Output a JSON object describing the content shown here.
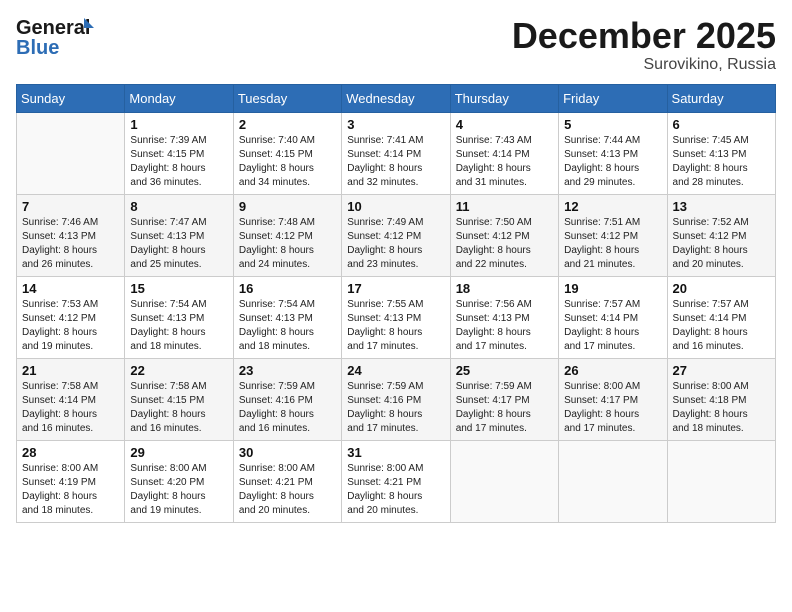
{
  "header": {
    "logo_general": "General",
    "logo_blue": "Blue",
    "month_title": "December 2025",
    "location": "Surovikino, Russia"
  },
  "weekdays": [
    "Sunday",
    "Monday",
    "Tuesday",
    "Wednesday",
    "Thursday",
    "Friday",
    "Saturday"
  ],
  "weeks": [
    [
      {
        "day": "",
        "info": ""
      },
      {
        "day": "1",
        "info": "Sunrise: 7:39 AM\nSunset: 4:15 PM\nDaylight: 8 hours\nand 36 minutes."
      },
      {
        "day": "2",
        "info": "Sunrise: 7:40 AM\nSunset: 4:15 PM\nDaylight: 8 hours\nand 34 minutes."
      },
      {
        "day": "3",
        "info": "Sunrise: 7:41 AM\nSunset: 4:14 PM\nDaylight: 8 hours\nand 32 minutes."
      },
      {
        "day": "4",
        "info": "Sunrise: 7:43 AM\nSunset: 4:14 PM\nDaylight: 8 hours\nand 31 minutes."
      },
      {
        "day": "5",
        "info": "Sunrise: 7:44 AM\nSunset: 4:13 PM\nDaylight: 8 hours\nand 29 minutes."
      },
      {
        "day": "6",
        "info": "Sunrise: 7:45 AM\nSunset: 4:13 PM\nDaylight: 8 hours\nand 28 minutes."
      }
    ],
    [
      {
        "day": "7",
        "info": "Sunrise: 7:46 AM\nSunset: 4:13 PM\nDaylight: 8 hours\nand 26 minutes."
      },
      {
        "day": "8",
        "info": "Sunrise: 7:47 AM\nSunset: 4:13 PM\nDaylight: 8 hours\nand 25 minutes."
      },
      {
        "day": "9",
        "info": "Sunrise: 7:48 AM\nSunset: 4:12 PM\nDaylight: 8 hours\nand 24 minutes."
      },
      {
        "day": "10",
        "info": "Sunrise: 7:49 AM\nSunset: 4:12 PM\nDaylight: 8 hours\nand 23 minutes."
      },
      {
        "day": "11",
        "info": "Sunrise: 7:50 AM\nSunset: 4:12 PM\nDaylight: 8 hours\nand 22 minutes."
      },
      {
        "day": "12",
        "info": "Sunrise: 7:51 AM\nSunset: 4:12 PM\nDaylight: 8 hours\nand 21 minutes."
      },
      {
        "day": "13",
        "info": "Sunrise: 7:52 AM\nSunset: 4:12 PM\nDaylight: 8 hours\nand 20 minutes."
      }
    ],
    [
      {
        "day": "14",
        "info": "Sunrise: 7:53 AM\nSunset: 4:12 PM\nDaylight: 8 hours\nand 19 minutes."
      },
      {
        "day": "15",
        "info": "Sunrise: 7:54 AM\nSunset: 4:13 PM\nDaylight: 8 hours\nand 18 minutes."
      },
      {
        "day": "16",
        "info": "Sunrise: 7:54 AM\nSunset: 4:13 PM\nDaylight: 8 hours\nand 18 minutes."
      },
      {
        "day": "17",
        "info": "Sunrise: 7:55 AM\nSunset: 4:13 PM\nDaylight: 8 hours\nand 17 minutes."
      },
      {
        "day": "18",
        "info": "Sunrise: 7:56 AM\nSunset: 4:13 PM\nDaylight: 8 hours\nand 17 minutes."
      },
      {
        "day": "19",
        "info": "Sunrise: 7:57 AM\nSunset: 4:14 PM\nDaylight: 8 hours\nand 17 minutes."
      },
      {
        "day": "20",
        "info": "Sunrise: 7:57 AM\nSunset: 4:14 PM\nDaylight: 8 hours\nand 16 minutes."
      }
    ],
    [
      {
        "day": "21",
        "info": "Sunrise: 7:58 AM\nSunset: 4:14 PM\nDaylight: 8 hours\nand 16 minutes."
      },
      {
        "day": "22",
        "info": "Sunrise: 7:58 AM\nSunset: 4:15 PM\nDaylight: 8 hours\nand 16 minutes."
      },
      {
        "day": "23",
        "info": "Sunrise: 7:59 AM\nSunset: 4:16 PM\nDaylight: 8 hours\nand 16 minutes."
      },
      {
        "day": "24",
        "info": "Sunrise: 7:59 AM\nSunset: 4:16 PM\nDaylight: 8 hours\nand 17 minutes."
      },
      {
        "day": "25",
        "info": "Sunrise: 7:59 AM\nSunset: 4:17 PM\nDaylight: 8 hours\nand 17 minutes."
      },
      {
        "day": "26",
        "info": "Sunrise: 8:00 AM\nSunset: 4:17 PM\nDaylight: 8 hours\nand 17 minutes."
      },
      {
        "day": "27",
        "info": "Sunrise: 8:00 AM\nSunset: 4:18 PM\nDaylight: 8 hours\nand 18 minutes."
      }
    ],
    [
      {
        "day": "28",
        "info": "Sunrise: 8:00 AM\nSunset: 4:19 PM\nDaylight: 8 hours\nand 18 minutes."
      },
      {
        "day": "29",
        "info": "Sunrise: 8:00 AM\nSunset: 4:20 PM\nDaylight: 8 hours\nand 19 minutes."
      },
      {
        "day": "30",
        "info": "Sunrise: 8:00 AM\nSunset: 4:21 PM\nDaylight: 8 hours\nand 20 minutes."
      },
      {
        "day": "31",
        "info": "Sunrise: 8:00 AM\nSunset: 4:21 PM\nDaylight: 8 hours\nand 20 minutes."
      },
      {
        "day": "",
        "info": ""
      },
      {
        "day": "",
        "info": ""
      },
      {
        "day": "",
        "info": ""
      }
    ]
  ]
}
